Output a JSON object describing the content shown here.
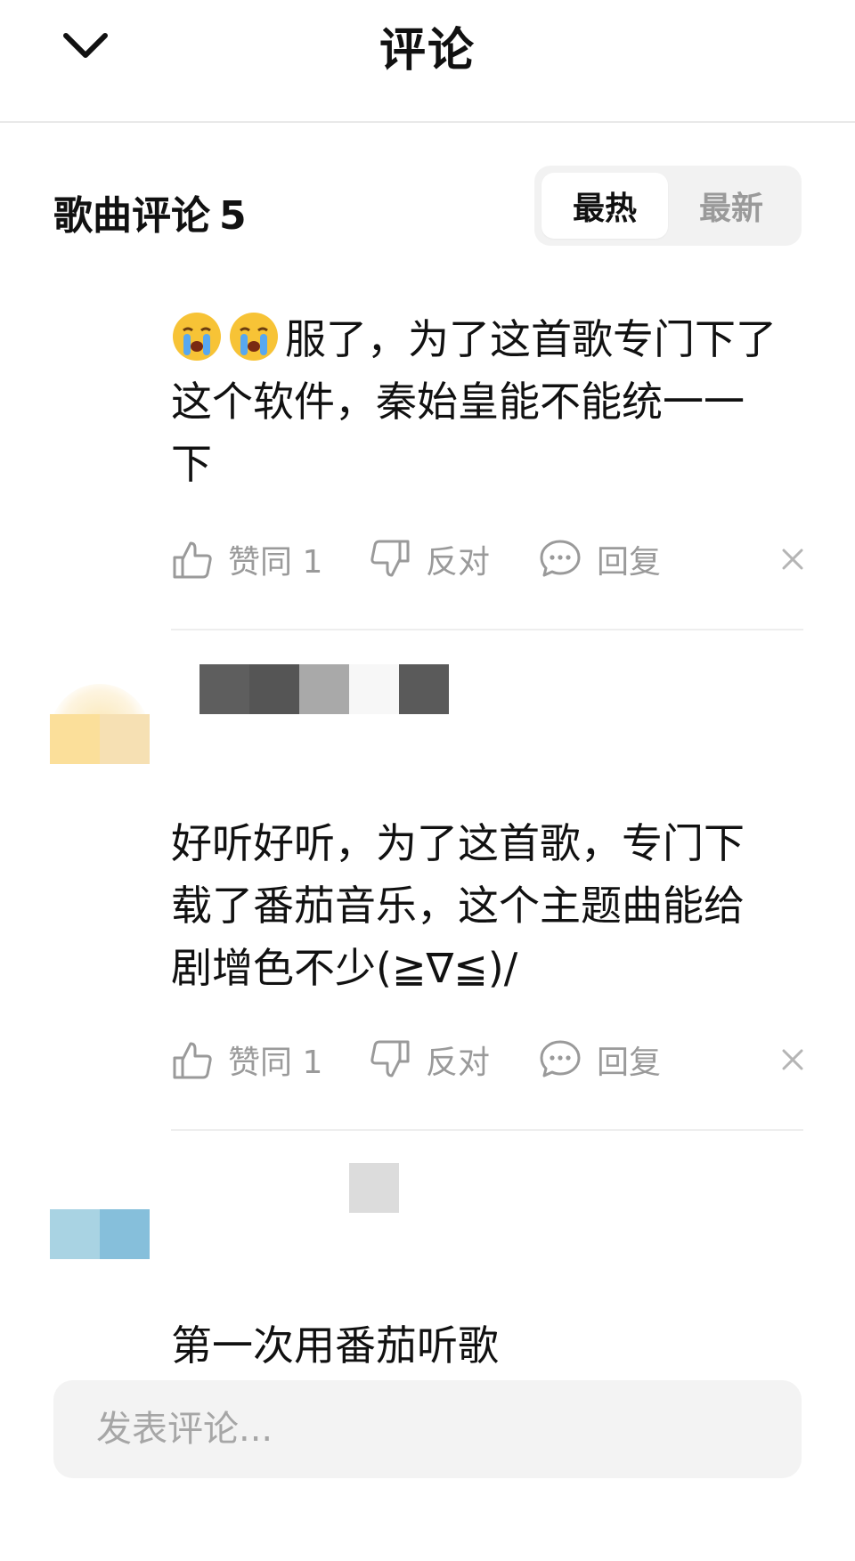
{
  "header": {
    "title": "评论",
    "back_icon": "chevron-down-icon"
  },
  "section": {
    "title": "歌曲评论",
    "count": "5"
  },
  "sort_tabs": [
    {
      "label": "最热",
      "active": true
    },
    {
      "label": "最新",
      "active": false
    }
  ],
  "comments": [
    {
      "emoji_icon": "crying-face-icon",
      "text_lines": [
        "服了，为了这首歌专门下了",
        "这个软件，秦始皇能不能统一一",
        "下"
      ],
      "like_label": "赞同 1",
      "dislike_label": "反对",
      "reply_label": "回复"
    },
    {
      "text_lines": [
        "好听好听，为了这首歌，专门下",
        "载了番茄音乐，这个主题曲能给",
        "剧增色不少(≧∇≦)/"
      ],
      "like_label": "赞同 1",
      "dislike_label": "反对",
      "reply_label": "回复"
    },
    {
      "text_lines": [
        "第一次用番茄听歌"
      ]
    }
  ],
  "input": {
    "placeholder": "发表评论..."
  },
  "colors": {
    "text": "#111111",
    "muted": "#9a9a9a",
    "toggle_bg": "#f2f2f2",
    "input_bg": "#f3f3f3"
  }
}
